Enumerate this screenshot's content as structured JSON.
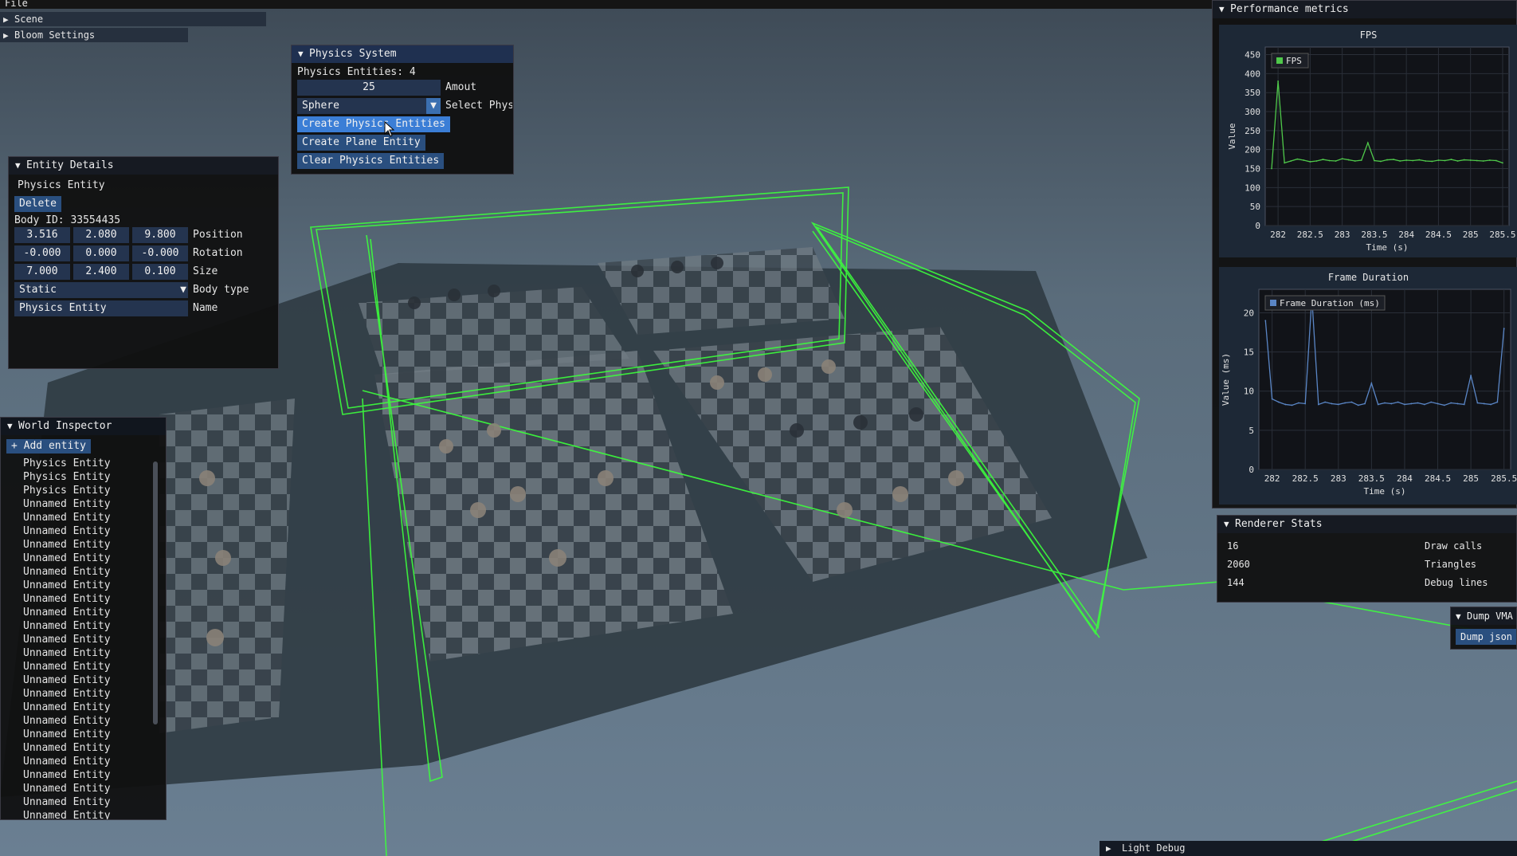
{
  "menubar": {
    "file": "File"
  },
  "scene": {
    "title": "Scene"
  },
  "bloom": {
    "title": "Bloom Settings"
  },
  "physics": {
    "title": "Physics System",
    "entities_count": "Physics Entities: 4",
    "amount_value": "25",
    "amount_label": "Amout",
    "shape_value": "Sphere",
    "shape_label": "Select Physic",
    "create_entities": "Create Physics Entities",
    "create_plane": "Create Plane Entity",
    "clear_entities": "Clear Physics Entities"
  },
  "entity_details": {
    "title": "Entity Details",
    "name_heading": "Physics Entity",
    "delete": "Delete",
    "body_id": "Body ID: 33554435",
    "position": [
      "3.516",
      "2.080",
      "9.800"
    ],
    "position_label": "Position",
    "rotation": [
      "-0.000",
      "0.000",
      "-0.000"
    ],
    "rotation_label": "Rotation",
    "size": [
      "7.000",
      "2.400",
      "0.100"
    ],
    "size_label": "Size",
    "body_type_value": "Static",
    "body_type_label": "Body type",
    "name_value": "Physics Entity",
    "name_label": "Name"
  },
  "world_inspector": {
    "title": "World Inspector",
    "add_entity": "+ Add entity",
    "items": [
      "Physics Entity",
      "Physics Entity",
      "Physics Entity",
      "Unnamed Entity",
      "Unnamed Entity",
      "Unnamed Entity",
      "Unnamed Entity",
      "Unnamed Entity",
      "Unnamed Entity",
      "Unnamed Entity",
      "Unnamed Entity",
      "Unnamed Entity",
      "Unnamed Entity",
      "Unnamed Entity",
      "Unnamed Entity",
      "Unnamed Entity",
      "Unnamed Entity",
      "Unnamed Entity",
      "Unnamed Entity",
      "Unnamed Entity",
      "Unnamed Entity",
      "Unnamed Entity",
      "Unnamed Entity",
      "Unnamed Entity",
      "Unnamed Entity",
      "Unnamed Entity",
      "Unnamed Entity"
    ]
  },
  "perf": {
    "title": "Performance metrics",
    "fps_title": "FPS",
    "fps_legend": "FPS",
    "fps_ylabel": "Value",
    "fps_yticks": [
      "450",
      "400",
      "350",
      "300",
      "250",
      "200",
      "150",
      "100",
      "50",
      "0"
    ],
    "xticks": [
      "282",
      "282.5",
      "283",
      "283.5",
      "284",
      "284.5",
      "285",
      "285.5"
    ],
    "xlabel": "Time (s)",
    "frame_title": "Frame Duration",
    "frame_legend": "Frame Duration (ms)",
    "frame_ylabel": "Value (ms)",
    "frame_yticks": [
      "20",
      "15",
      "10",
      "5",
      "0"
    ]
  },
  "renderer": {
    "title": "Renderer Stats",
    "rows": [
      {
        "value": "16",
        "label": "Draw calls"
      },
      {
        "value": "2060",
        "label": "Triangles"
      },
      {
        "value": "144",
        "label": "Debug lines"
      }
    ]
  },
  "dump": {
    "title": "Dump VMA",
    "button": "Dump json"
  },
  "light": {
    "title": "Light Debug"
  },
  "colors": {
    "accent": "#3b7ed6",
    "fps_line": "#4fc84a",
    "frame_line": "#5a86c6",
    "wire": "#3cff3c"
  },
  "chart_data": [
    {
      "type": "line",
      "title": "FPS",
      "xlabel": "Time (s)",
      "ylabel": "Value",
      "xlim": [
        281.8,
        285.6
      ],
      "ylim": [
        0,
        470
      ],
      "series": [
        {
          "name": "FPS",
          "x": [
            281.9,
            282.0,
            282.1,
            282.2,
            282.3,
            282.4,
            282.5,
            282.6,
            282.7,
            282.8,
            282.9,
            283.0,
            283.1,
            283.2,
            283.3,
            283.4,
            283.5,
            283.6,
            283.7,
            283.8,
            283.9,
            284.0,
            284.1,
            284.2,
            284.3,
            284.4,
            284.5,
            284.6,
            284.7,
            284.8,
            284.9,
            285.0,
            285.1,
            285.2,
            285.3,
            285.4,
            285.5
          ],
          "values": [
            150,
            380,
            165,
            170,
            175,
            172,
            168,
            170,
            174,
            171,
            170,
            176,
            173,
            170,
            172,
            218,
            171,
            169,
            173,
            174,
            170,
            172,
            171,
            173,
            170,
            169,
            172,
            171,
            174,
            170,
            173,
            172,
            171,
            170,
            172,
            171,
            165
          ]
        }
      ]
    },
    {
      "type": "line",
      "title": "Frame Duration",
      "xlabel": "Time (s)",
      "ylabel": "Value (ms)",
      "xlim": [
        281.8,
        285.6
      ],
      "ylim": [
        0,
        23
      ],
      "series": [
        {
          "name": "Frame Duration (ms)",
          "x": [
            281.9,
            282.0,
            282.1,
            282.2,
            282.3,
            282.4,
            282.5,
            282.6,
            282.7,
            282.8,
            282.9,
            283.0,
            283.1,
            283.2,
            283.3,
            283.4,
            283.5,
            283.6,
            283.7,
            283.8,
            283.9,
            284.0,
            284.1,
            284.2,
            284.3,
            284.4,
            284.5,
            284.6,
            284.7,
            284.8,
            284.9,
            285.0,
            285.1,
            285.2,
            285.3,
            285.4,
            285.5
          ],
          "values": [
            19,
            9,
            8.6,
            8.3,
            8.2,
            8.5,
            8.4,
            22,
            8.3,
            8.6,
            8.4,
            8.3,
            8.5,
            8.6,
            8.2,
            8.4,
            11,
            8.3,
            8.5,
            8.4,
            8.6,
            8.3,
            8.4,
            8.5,
            8.3,
            8.6,
            8.4,
            8.2,
            8.5,
            8.4,
            8.3,
            12,
            8.5,
            8.4,
            8.3,
            8.6,
            18
          ]
        }
      ]
    }
  ]
}
